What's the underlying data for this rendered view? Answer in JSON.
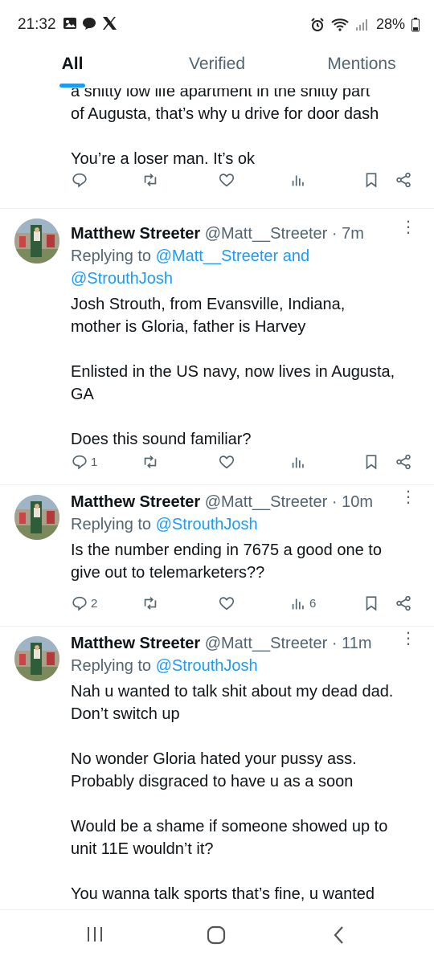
{
  "status": {
    "time": "21:32",
    "battery": "28%"
  },
  "tabs": [
    {
      "label": "All"
    },
    {
      "label": "Verified"
    },
    {
      "label": "Mentions"
    }
  ],
  "tweets": [
    {
      "lines": [
        "a shitty low life apartment in the shitty part",
        "of Augusta, that’s why u drive for door dash",
        "",
        "You’re a loser man. It’s ok"
      ],
      "reply_count": "",
      "view_count": ""
    },
    {
      "name": "Matthew Streeter",
      "handle": "@Matt__Streeter",
      "sep": "·",
      "time": "7m",
      "replying_prefix": "Replying to",
      "replying_to": "@Matt__Streeter and",
      "replying_to_2": "@StrouthJosh",
      "lines": [
        "Josh Strouth, from Evansville, Indiana,",
        "mother is Gloria, father is Harvey",
        "",
        "Enlisted in the US navy, now lives in Augusta,",
        "GA",
        "",
        "Does this sound familiar?"
      ],
      "reply_count": "1",
      "view_count": ""
    },
    {
      "name": "Matthew Streeter",
      "handle": "@Matt__Streeter",
      "sep": "·",
      "time": "10m",
      "replying_prefix": "Replying to",
      "replying_to": "@StrouthJosh",
      "lines": [
        "Is the number ending in 7675 a good one to",
        "give out to telemarketers??"
      ],
      "reply_count": "2",
      "view_count": "6"
    },
    {
      "name": "Matthew Streeter",
      "handle": "@Matt__Streeter",
      "sep": "·",
      "time": "11m",
      "replying_prefix": "Replying to",
      "replying_to": "@StrouthJosh",
      "lines": [
        "Nah u wanted to talk shit about my dead dad.",
        "Don’t switch up",
        "",
        "No wonder Gloria hated your pussy ass.",
        "Probably disgraced to have u as a soon",
        "",
        "Would be a shame if someone showed up to",
        "unit 11E wouldn’t it?",
        "",
        "You wanna talk sports that’s fine, u wanted"
      ]
    }
  ],
  "icons": {
    "reply": "reply-icon",
    "retweet": "retweet-icon",
    "like": "like-icon",
    "views": "views-icon",
    "bookmark": "bookmark-icon",
    "share": "share-icon"
  },
  "colors": {
    "accent": "#1d9bf0",
    "muted": "#536471",
    "text": "#0f1419"
  }
}
